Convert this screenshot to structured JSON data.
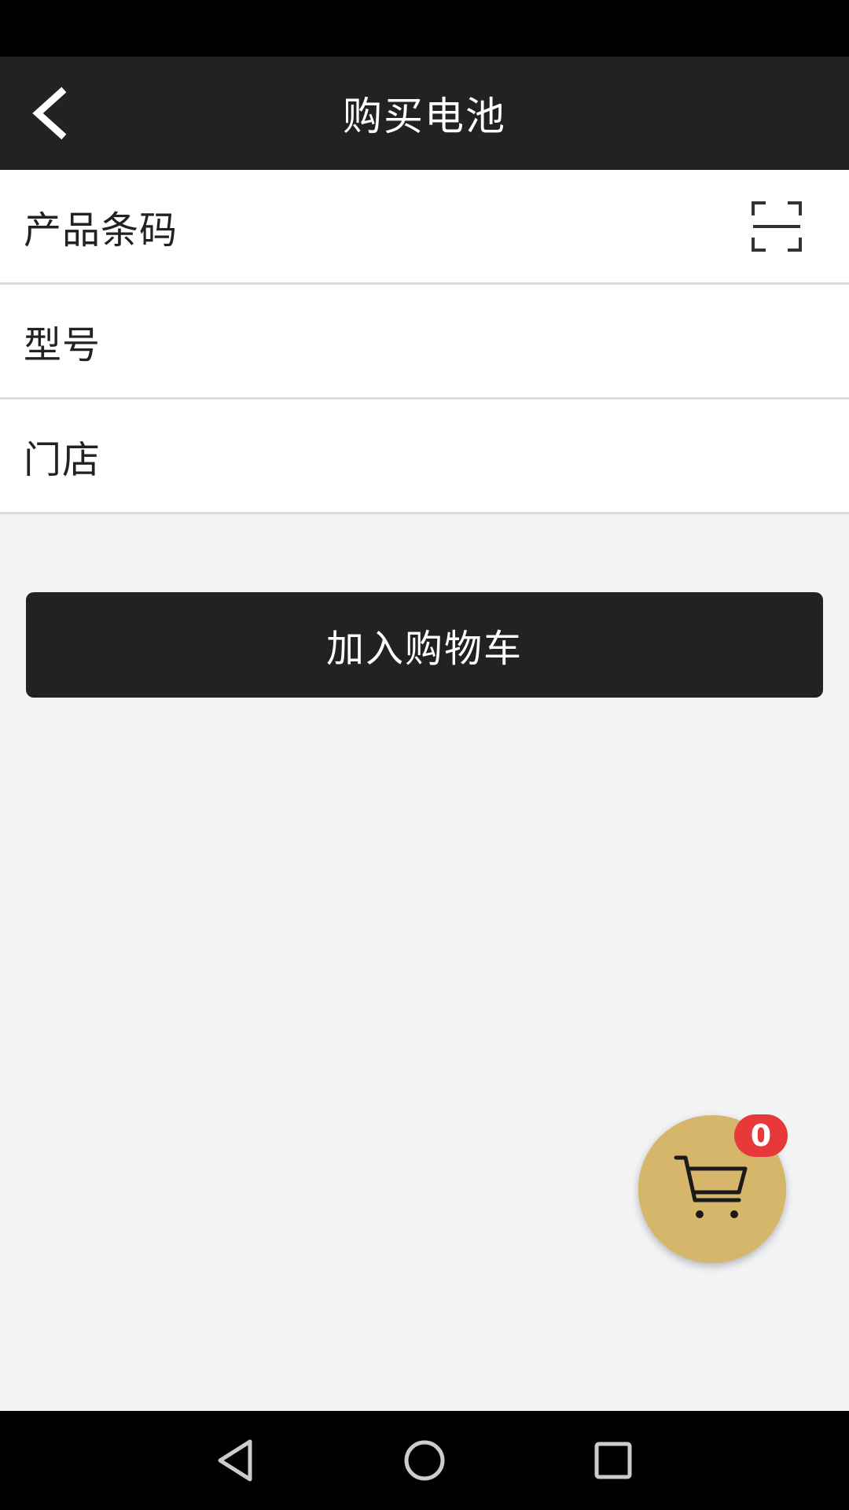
{
  "header": {
    "title": "购买电池",
    "back_icon": "chevron-left-icon"
  },
  "form": {
    "fields": [
      {
        "label": "产品条码",
        "value": "",
        "icon": "scan-icon"
      },
      {
        "label": "型号",
        "value": ""
      },
      {
        "label": "门店",
        "value": ""
      }
    ]
  },
  "actions": {
    "add_to_cart_label": "加入购物车"
  },
  "cart": {
    "icon": "cart-icon",
    "count": "0"
  },
  "colors": {
    "app_bar": "#222222",
    "background": "#f2f3f5",
    "cart_fab": "#d6b66b",
    "badge": "#e8393a"
  },
  "system_nav": {
    "back_icon": "triangle-back-icon",
    "home_icon": "circle-home-icon",
    "recents_icon": "square-recents-icon"
  }
}
